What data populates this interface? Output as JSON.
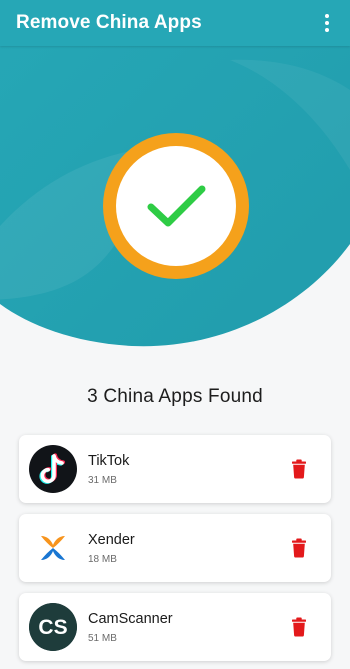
{
  "app_bar": {
    "title": "Remove China Apps",
    "menu_icon": "more-vert-icon"
  },
  "status": {
    "icon": "check-icon",
    "ring_color": "#f5a11b",
    "check_color": "#2ecc45"
  },
  "summary": {
    "found_text": "3 China Apps Found"
  },
  "apps": [
    {
      "name": "TikTok",
      "size": "31 MB",
      "icon": "tiktok-icon"
    },
    {
      "name": "Xender",
      "size": "18 MB",
      "icon": "xender-icon"
    },
    {
      "name": "CamScanner",
      "size": "51 MB",
      "icon": "camscanner-icon",
      "icon_text": "CS"
    }
  ],
  "colors": {
    "primary": "#26a7b6",
    "delete": "#e3191b"
  }
}
